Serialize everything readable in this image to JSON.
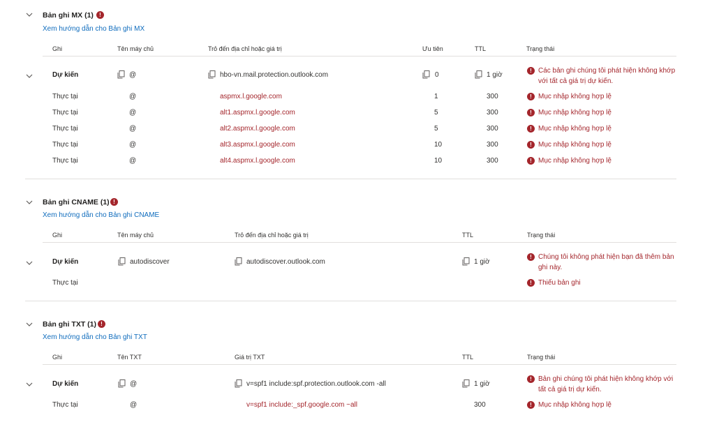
{
  "mx": {
    "title": "Bản ghi MX (1)",
    "guide_link": "Xem hướng dẫn cho Bản ghi MX",
    "headers": [
      "Ghi",
      "Tên máy chủ",
      "Trỏ đến địa chỉ hoặc giá trị",
      "Ưu tiên",
      "TTL",
      "Trạng thái"
    ],
    "expected": {
      "type": "Dự kiến",
      "host": "@",
      "value": "hbo-vn.mail.protection.outlook.com",
      "priority": "0",
      "ttl": "1 giờ",
      "status": "Các bản ghi chúng tôi phát hiện không khớp với tất cả giá trị dự kiến."
    },
    "actual": [
      {
        "type": "Thực tại",
        "host": "@",
        "value": "aspmx.l.google.com",
        "priority": "1",
        "ttl": "300",
        "status": "Mục nhập không hợp lệ"
      },
      {
        "type": "Thực tại",
        "host": "@",
        "value": "alt1.aspmx.l.google.com",
        "priority": "5",
        "ttl": "300",
        "status": "Mục nhập không hợp lệ"
      },
      {
        "type": "Thực tại",
        "host": "@",
        "value": "alt2.aspmx.l.google.com",
        "priority": "5",
        "ttl": "300",
        "status": "Mục nhập không hợp lệ"
      },
      {
        "type": "Thực tại",
        "host": "@",
        "value": "alt3.aspmx.l.google.com",
        "priority": "10",
        "ttl": "300",
        "status": "Mục nhập không hợp lệ"
      },
      {
        "type": "Thực tại",
        "host": "@",
        "value": "alt4.aspmx.l.google.com",
        "priority": "10",
        "ttl": "300",
        "status": "Mục nhập không hợp lệ"
      }
    ]
  },
  "cname": {
    "title": "Bản ghi CNAME (1)",
    "guide_link": "Xem hướng dẫn cho Bản ghi CNAME",
    "headers": [
      "Ghi",
      "Tên máy chủ",
      "Trỏ đến địa chỉ hoặc giá trị",
      "TTL",
      "Trạng thái"
    ],
    "expected": {
      "type": "Dự kiến",
      "host": "autodiscover",
      "value": "autodiscover.outlook.com",
      "ttl": "1 giờ",
      "status": "Chúng tôi không phát hiện bạn đã thêm bản ghi này."
    },
    "actual": {
      "type": "Thực tại",
      "status": "Thiếu bản ghi"
    }
  },
  "txt": {
    "title": "Bản ghi TXT (1)",
    "guide_link": "Xem hướng dẫn cho Bản ghi TXT",
    "headers": [
      "Ghi",
      "Tên TXT",
      "Giá trị TXT",
      "TTL",
      "Trạng thái"
    ],
    "expected": {
      "type": "Dự kiến",
      "host": "@",
      "value": "v=spf1 include:spf.protection.outlook.com -all",
      "ttl": "1 giờ",
      "status": "Bản ghi chúng tôi phát hiện không khớp với tất cả giá trị dự kiến."
    },
    "actual": {
      "type": "Thực tại",
      "host": "@",
      "value": "v=spf1 include:_spf.google.com ~all",
      "ttl": "300",
      "status": "Mục nhập không hợp lệ"
    }
  },
  "icons": {
    "error": "!",
    "chevron": "chevron-down-icon",
    "copy": "copy-icon"
  },
  "colors": {
    "error": "#a4262c",
    "link": "#0f6cbd",
    "divider": "#e1dfdd"
  }
}
